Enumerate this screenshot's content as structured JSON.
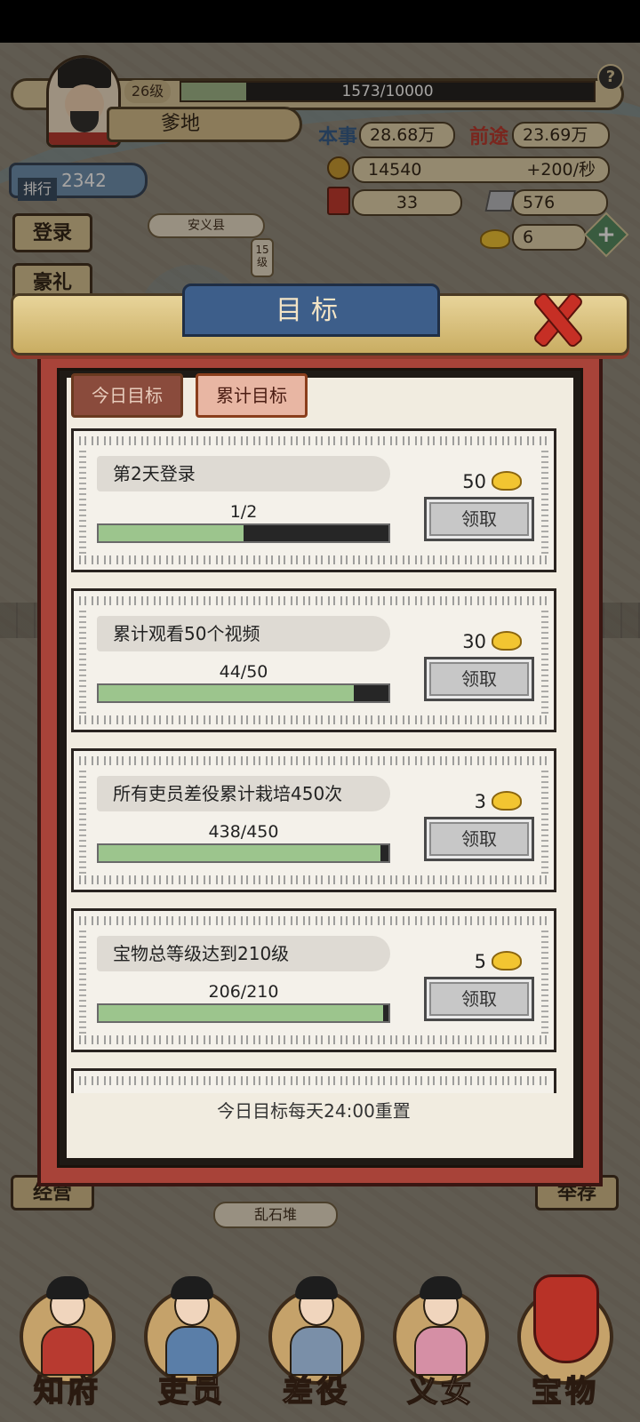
{
  "player": {
    "level": "26级",
    "exp_text": "1573/10000",
    "exp_fraction": 0.1573,
    "name": "爹地",
    "benshi_label": "本事",
    "benshi_value": "28.68万",
    "qiantu_label": "前途",
    "qiantu_value": "23.69万",
    "rank_label": "排行",
    "rank_value": "2342"
  },
  "resources": {
    "coins": "14540",
    "coin_rate": "+200/秒",
    "scrolls": "33",
    "stone": "576",
    "gold": "6"
  },
  "side_menu": {
    "login": "登录",
    "gift": "豪礼",
    "manage": "经营",
    "recommend": "举荐"
  },
  "map": {
    "county_label": "安义县",
    "county_level": "15级",
    "bottom_label": "乱石堆"
  },
  "dialog": {
    "title": "目标",
    "tab_daily": "今日目标",
    "tab_cumulative": "累计目标",
    "reset_note": "今日目标每天24:00重置",
    "tasks": [
      {
        "title": "第2天登录",
        "progress_text": "1/2",
        "progress": 0.5,
        "reward": "50",
        "claim": "领取"
      },
      {
        "title": "累计观看50个视频",
        "progress_text": "44/50",
        "progress": 0.88,
        "reward": "30",
        "claim": "领取"
      },
      {
        "title": "所有吏员差役累计栽培450次",
        "progress_text": "438/450",
        "progress": 0.973,
        "reward": "3",
        "claim": "领取"
      },
      {
        "title": "宝物总等级达到210级",
        "progress_text": "206/210",
        "progress": 0.981,
        "reward": "5",
        "claim": "领取"
      }
    ]
  },
  "bottom_nav": [
    {
      "label": "知府",
      "color": "#b83a30"
    },
    {
      "label": "吏员",
      "color": "#5a7ea8"
    },
    {
      "label": "差役",
      "color": "#7a8fa8"
    },
    {
      "label": "义女",
      "color": "#d58fa5"
    },
    {
      "label": "宝物",
      "color": "#b83227"
    }
  ],
  "colors": {
    "accent_red": "#a84339",
    "header_blue": "#3d5e8a",
    "progress_green": "#9cc58d"
  }
}
